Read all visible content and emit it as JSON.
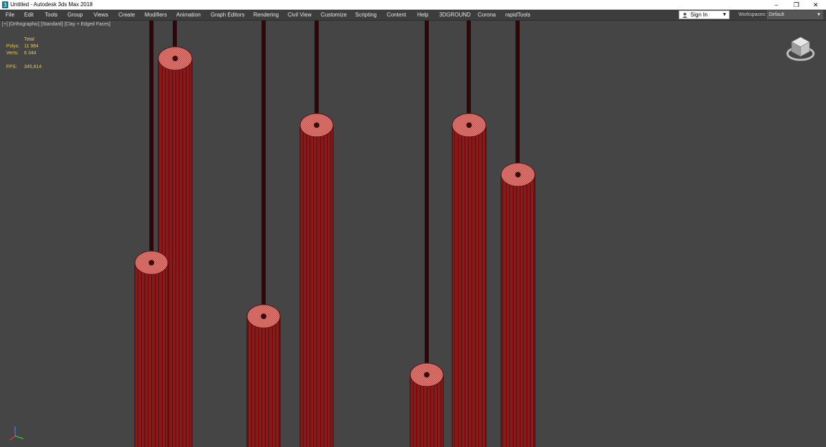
{
  "window": {
    "title": "Untitled - Autodesk 3ds Max 2018",
    "controls": [
      "–",
      "❐",
      "✕"
    ]
  },
  "menu": {
    "items": [
      "File",
      "Edit",
      "Tools",
      "Group",
      "Views",
      "Create",
      "Modifiers",
      "Animation",
      "Graph Editors",
      "Rendering",
      "Civil View",
      "Customize",
      "Scripting",
      "Content",
      "Help",
      "3DGROUND",
      "Corona",
      "rapidTools"
    ]
  },
  "account": {
    "sign_in": "Sign In"
  },
  "workspaces": {
    "label": "Workspaces:",
    "value": "Default"
  },
  "viewport": {
    "label": "[+] [Orthographic] [Standard] [Clay + Edged Faces]",
    "stats": {
      "header": "Total",
      "polys_label": "Polys:",
      "polys_value": "11 984",
      "verts_label": "Verts:",
      "verts_value": "6 344",
      "fps_label": "FPS:",
      "fps_value": "345,614"
    }
  },
  "colors": {
    "cylinder": "#8c1b1b",
    "rod": "#3a0c0c",
    "viewport_bg": "#454545",
    "stats_text": "#e6c84a"
  },
  "icons": {
    "app": "3dsmax-logo-icon",
    "user": "user-icon",
    "viewcube": "viewcube-icon",
    "axis": "axis-tripod-icon"
  }
}
